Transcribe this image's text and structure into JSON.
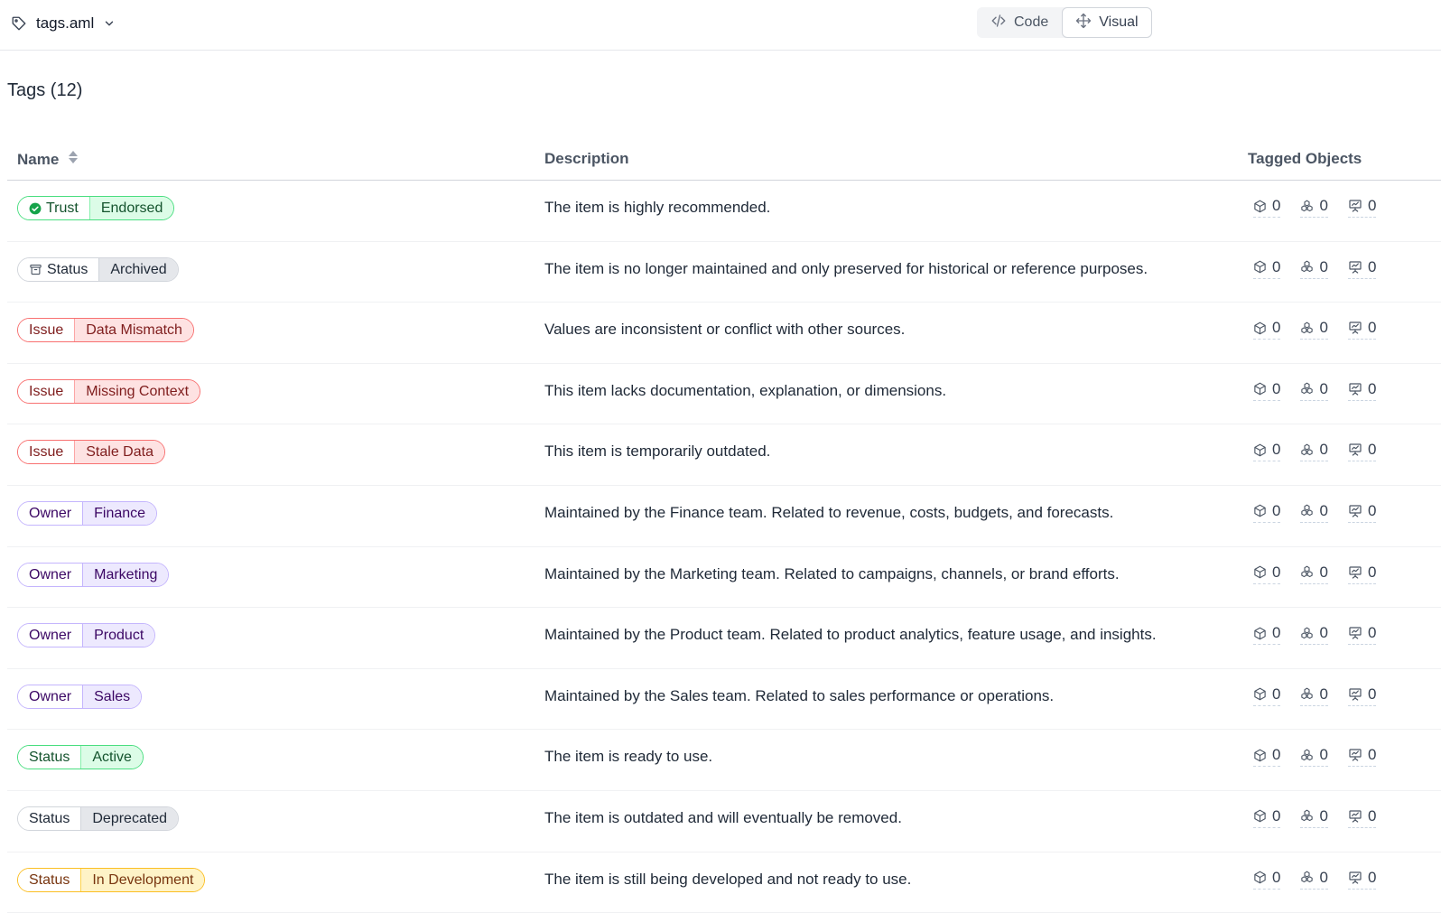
{
  "header": {
    "file_name": "tags.aml",
    "file_icon": "tag-icon",
    "views": [
      {
        "label": "Code",
        "icon": "code-icon",
        "active": false
      },
      {
        "label": "Visual",
        "icon": "move-icon",
        "active": true
      }
    ]
  },
  "page": {
    "title": "Tags (12)"
  },
  "table": {
    "headers": {
      "name": "Name",
      "description": "Description",
      "tagged": "Tagged Objects"
    },
    "count_icons": [
      "cube-icon",
      "dataset-icon",
      "dashboard-icon"
    ],
    "rows": [
      {
        "key": "Trust",
        "value": "Endorsed",
        "key_icon": "check-circle-icon",
        "color": "trust",
        "description": "The item is highly recommended.",
        "counts": [
          "0",
          "0",
          "0"
        ]
      },
      {
        "key": "Status",
        "value": "Archived",
        "key_icon": "archive-icon",
        "color": "gray",
        "description": "The item is no longer maintained and only preserved for historical or reference purposes.",
        "counts": [
          "0",
          "0",
          "0"
        ]
      },
      {
        "key": "Issue",
        "value": "Data Mismatch",
        "key_icon": "",
        "color": "red",
        "description": "Values are inconsistent or conflict with other sources.",
        "counts": [
          "0",
          "0",
          "0"
        ]
      },
      {
        "key": "Issue",
        "value": "Missing Context",
        "key_icon": "",
        "color": "red",
        "description": "This item lacks documentation, explanation, or dimensions.",
        "counts": [
          "0",
          "0",
          "0"
        ]
      },
      {
        "key": "Issue",
        "value": "Stale Data",
        "key_icon": "",
        "color": "red",
        "description": "This item is temporarily outdated.",
        "counts": [
          "0",
          "0",
          "0"
        ]
      },
      {
        "key": "Owner",
        "value": "Finance",
        "key_icon": "",
        "color": "purple",
        "description": "Maintained by the Finance team. Related to revenue, costs, budgets, and forecasts.",
        "counts": [
          "0",
          "0",
          "0"
        ]
      },
      {
        "key": "Owner",
        "value": "Marketing",
        "key_icon": "",
        "color": "purple",
        "description": "Maintained by the Marketing team. Related to campaigns, channels, or brand efforts.",
        "counts": [
          "0",
          "0",
          "0"
        ]
      },
      {
        "key": "Owner",
        "value": "Product",
        "key_icon": "",
        "color": "purple",
        "description": "Maintained by the Product team. Related to product analytics, feature usage, and insights.",
        "counts": [
          "0",
          "0",
          "0"
        ]
      },
      {
        "key": "Owner",
        "value": "Sales",
        "key_icon": "",
        "color": "purple",
        "description": "Maintained by the Sales team. Related to sales performance or operations.",
        "counts": [
          "0",
          "0",
          "0"
        ]
      },
      {
        "key": "Status",
        "value": "Active",
        "key_icon": "",
        "color": "green",
        "description": "The item is ready to use.",
        "counts": [
          "0",
          "0",
          "0"
        ]
      },
      {
        "key": "Status",
        "value": "Deprecated",
        "key_icon": "",
        "color": "gray",
        "description": "The item is outdated and will eventually be removed.",
        "counts": [
          "0",
          "0",
          "0"
        ]
      },
      {
        "key": "Status",
        "value": "In Development",
        "key_icon": "",
        "color": "amber",
        "description": "The item is still being developed and not ready to use.",
        "counts": [
          "0",
          "0",
          "0"
        ]
      }
    ]
  }
}
